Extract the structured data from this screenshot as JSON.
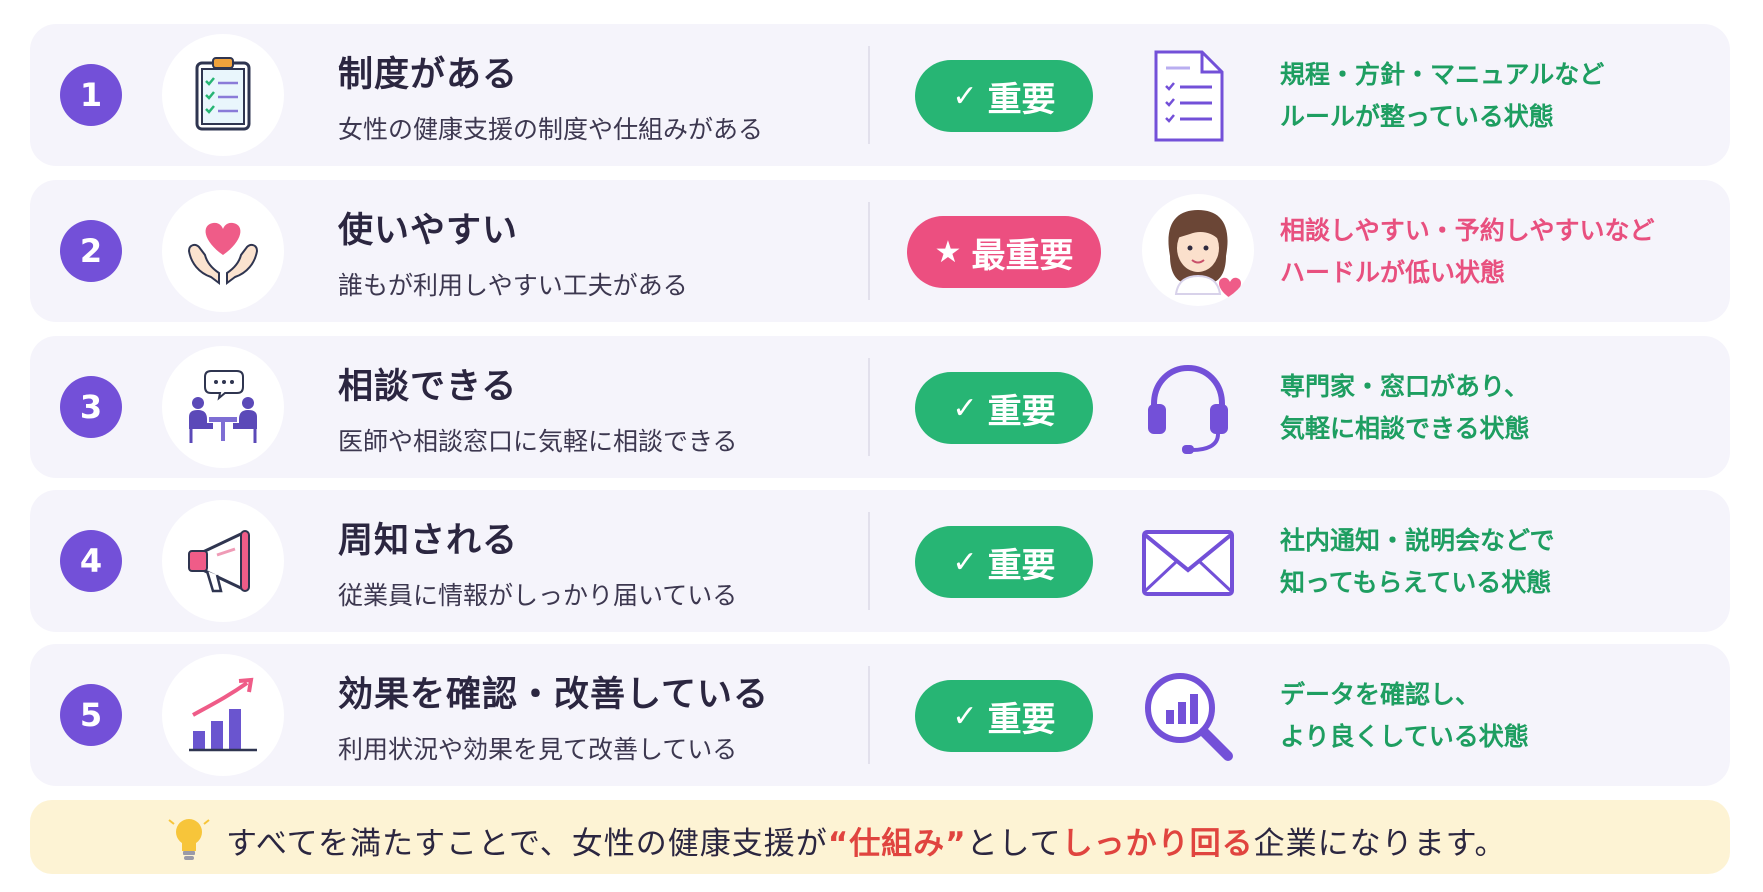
{
  "rows": [
    {
      "number": "1",
      "title": "制度がある",
      "description": "女性の健康支援の制度や仕組みがある",
      "icon": "clipboard-checklist-icon",
      "badge": {
        "icon": "✓",
        "label": "重要",
        "color": "#27b574"
      },
      "right_icon": "document-list-icon",
      "right_text": [
        "規程・方針・マニュアルなど",
        "ルールが整っている状態"
      ]
    },
    {
      "number": "2",
      "title": "使いやすい",
      "description": "誰もが利用しやすい工夫がある",
      "icon": "heart-hands-icon",
      "badge": {
        "icon": "★",
        "label": "最重要",
        "color": "#ec4f80"
      },
      "right_icon": "woman-heart-avatar-icon",
      "right_text": [
        "相談しやすい・予約しやすいなど",
        "ハードルが低い状態"
      ]
    },
    {
      "number": "3",
      "title": "相談できる",
      "description": "医師や相談窓口に気軽に相談できる",
      "icon": "consultation-icon",
      "badge": {
        "icon": "✓",
        "label": "重要",
        "color": "#27b574"
      },
      "right_icon": "headset-icon",
      "right_text": [
        "専門家・窓口があり、",
        "気軽に相談できる状態"
      ]
    },
    {
      "number": "4",
      "title": "周知される",
      "description": "従業員に情報がしっかり届いている",
      "icon": "megaphone-icon",
      "badge": {
        "icon": "✓",
        "label": "重要",
        "color": "#27b574"
      },
      "right_icon": "envelope-icon",
      "right_text": [
        "社内通知・説明会などで",
        "知ってもらえている状態"
      ]
    },
    {
      "number": "5",
      "title": "効果を確認・改善している",
      "description": "利用状況や効果を見て改善している",
      "icon": "growth-chart-icon",
      "badge": {
        "icon": "✓",
        "label": "重要",
        "color": "#27b574"
      },
      "right_icon": "magnifier-chart-icon",
      "right_text": [
        "データを確認し、",
        "より良くしている状態"
      ]
    }
  ],
  "footer": {
    "icon": "lightbulb-icon",
    "text_1": "すべてを満たすことで、女性の健康支援が",
    "quote_open": "“",
    "highlight_1": "仕組み",
    "quote_close": "”",
    "text_2": "として",
    "highlight_2": "しっかり回る",
    "text_3": "企業になります。"
  },
  "colors": {
    "accent_purple": "#7350d8",
    "important_green": "#27b574",
    "top_priority_pink": "#ec4f80",
    "highlight_red": "#e0443f",
    "footer_bg": "#fdf3d4"
  }
}
